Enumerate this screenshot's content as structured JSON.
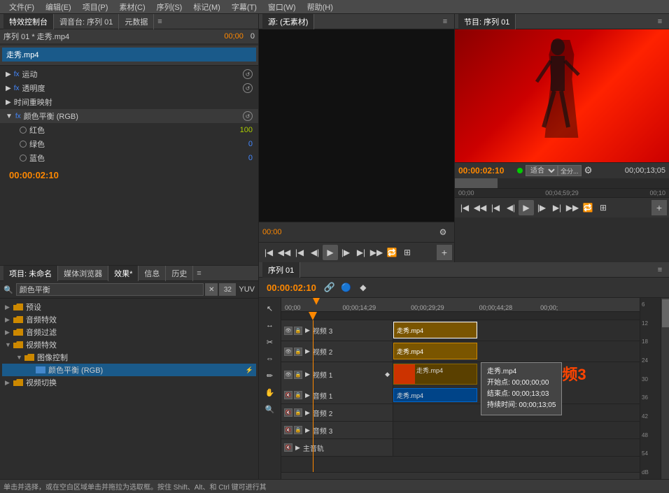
{
  "menu": {
    "items": [
      "文件(F)",
      "编辑(E)",
      "项目(P)",
      "素材(C)",
      "序列(S)",
      "标记(M)",
      "字幕(T)",
      "窗口(W)",
      "帮助(H)"
    ]
  },
  "effect_controls": {
    "tab_label": "特效控制台",
    "tab2": "调音台: 序列 01",
    "tab3": "元数据",
    "clip_name": "序列 01 * 走秀.mp4",
    "timecode": "00;00",
    "timecode_right": "0",
    "source_clip": "走秀.mp4",
    "motion_label": "运动",
    "opacity_label": "透明度",
    "time_remap_label": "时间重映射",
    "color_balance_label": "颜色平衡 (RGB)",
    "red_label": "红色",
    "red_value": "100",
    "green_label": "绿色",
    "green_value": "0",
    "blue_label": "蓝色",
    "blue_value": "0",
    "timestamp": "00:00:02:10"
  },
  "source_monitor": {
    "tab_label": "源: (无素材)",
    "no_content": ""
  },
  "program_monitor": {
    "tab_label": "节目: 序列 01",
    "timecode": "00:00:02:10",
    "fit_label": "适合",
    "fullscreen_label": "全分...",
    "duration": "00;00;13;05",
    "ruler_marks": [
      "00;00",
      "00;04;59;29"
    ],
    "ruler_right": "00;10"
  },
  "project_panel": {
    "tab_label": "项目: 未命名",
    "tab2": "媒体浏览器",
    "tab3": "效果*",
    "tab4": "信息",
    "tab5": "历史",
    "search_placeholder": "颜色平衡",
    "tree": [
      {
        "label": "预设",
        "level": 1
      },
      {
        "label": "音频特效",
        "level": 1
      },
      {
        "label": "音频过滤",
        "level": 1
      },
      {
        "label": "视频特效",
        "level": 1,
        "expanded": true
      },
      {
        "label": "图像控制",
        "level": 2,
        "expanded": true
      },
      {
        "label": "颜色平衡 (RGB)",
        "level": 3,
        "selected": true
      },
      {
        "label": "视频切换",
        "level": 1
      }
    ]
  },
  "timeline": {
    "tab_label": "序列 01",
    "timecode": "00:00:02:10",
    "ruler_labels": [
      "00;00",
      "00;00;14;29",
      "00;00;29;29",
      "00;00;44;28",
      "00;00;"
    ],
    "tracks": [
      {
        "name": "视频 3",
        "clip": "走秀.mp4",
        "type": "video"
      },
      {
        "name": "视频 2",
        "clip": "走秀.mp4",
        "type": "video"
      },
      {
        "name": "视频 1",
        "clip": "走秀.mp4",
        "type": "video",
        "has_thumbnail": true
      },
      {
        "name": "音频 1",
        "clip": "走秀.mp4",
        "type": "audio"
      },
      {
        "name": "音频 2",
        "clip": "",
        "type": "audio"
      },
      {
        "name": "音频 3",
        "clip": "",
        "type": "audio"
      },
      {
        "name": "主音轨",
        "clip": "",
        "type": "master"
      }
    ],
    "tooltip": {
      "clip_name": "走秀.mp4",
      "start": "开始点: 00;00;00;00",
      "end": "结束点: 00;00;13;03",
      "duration": "持续时间: 00;00;13;05"
    },
    "annotation": "1.先选中视频3",
    "db_labels": [
      "6",
      "12",
      "18",
      "24",
      "30",
      "36",
      "42",
      "48",
      "54",
      "dB"
    ]
  },
  "status_bar": {
    "text": "单击并选择，或在空白区域单击并拖拉为选取框。按住 Shift、Alt、和 Ctrl 键可进行其"
  }
}
